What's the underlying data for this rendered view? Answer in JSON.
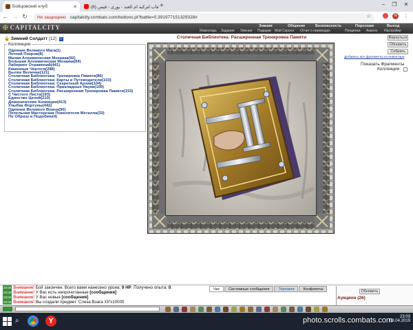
{
  "browser": {
    "tabs": [
      {
        "title": "Бойцовский клуб",
        "active": true
      },
      {
        "title": "(8) القاب لتركية ام العند - يورى - فيس",
        "active": false
      }
    ],
    "security": "Не защищено",
    "url": "capitalcity.combats.com/buttons.pl?battle=0.391977151329328#"
  },
  "game": {
    "logo": "CAPITALCITY",
    "menu_top": [
      "Знания",
      "Общение",
      "Безопасность",
      "Персонаж",
      "Выход"
    ],
    "menu_bottom": [
      "Инвентарь",
      "Задания",
      "Умения",
      "Подарки",
      "Мой Скролл",
      "Отчет о переводах",
      "Поединки",
      "Анкета",
      "Настройки"
    ]
  },
  "header": {
    "user": "Зимний Солдатт",
    "level": "[12]",
    "page_title": "Столичная Библиотека: Расширенная Тренировка Памяти"
  },
  "collections": {
    "legend": "Коллекции",
    "items": [
      "Одеяние Великого Мага(1)",
      "Летний Покров(8)",
      "Малая Алхимическая Мозаика(92)",
      "Большая Алхимическая Мозаика(94)",
      "Лабиринт Отражений(441)",
      "Каменные Чертоги(288)",
      "Былое Величие(121)",
      "Столичная Библиотека: Тренировка Памяти(86)",
      "Столичная Библиотека: Карты и Путеводители(103)",
      "Столичная Библиотека: Секретный Архив(104)",
      "Столичная Библиотека: Прикладные Науки(109)",
      "Столичная Библиотека: Расширенная Тренировка Памяти(153)",
      "С Чистого Листа(193)",
      "Единство Целей(210)",
      "Демонические Конкиции(413)",
      "Улыбка Фортуны(442)",
      "Одеяние Великого Воина(90)",
      "Пепельная Мастерская Повелителя Металла(33)",
      "По Образу и Подобию(4)"
    ]
  },
  "controls": {
    "back": "Вернуться",
    "refresh": "Обновить",
    "collect": "Собрать",
    "add_all": "Добавить все фрагменты из инвентаря",
    "show_fragments": "Показать Фрагменты",
    "collections_label": "Коллекции"
  },
  "chat": {
    "lines": [
      {
        "time": "23:00",
        "warn": "Внимание!",
        "text": "Бой закончен. Всего вами нанесено урона: ",
        "bold": "9 HP",
        "text2": ". Получено опыта: ",
        "bold2": "0",
        "text3": "."
      },
      {
        "time": "23:00",
        "warn": "Внимание!",
        "text": "У Вас есть непрочитанные ",
        "bold": "[сообщения]",
        "text2": "",
        "bold2": "",
        "text3": ""
      },
      {
        "time": "23:00",
        "warn": "Внимание!",
        "text": "У Вас новые ",
        "bold": "[сообщения]",
        "text2": "",
        "bold2": "",
        "text3": ""
      },
      {
        "time": "23:00",
        "warn": "Внимание!",
        "text": "Вы создали предмет 'Слеза Вэага XII'x10000",
        "bold": "",
        "text2": "",
        "bold2": "",
        "text3": ""
      }
    ],
    "tabs": [
      "Чат",
      "Системные сообщения",
      "Торговля",
      "Конфликты"
    ],
    "refresh": "Обновить",
    "auction": "Аукцион (26)"
  },
  "taskbar": {
    "clock_time": "23:03",
    "clock_date": "08.04.2019"
  },
  "watermark": "photo.scrolls.combats.com"
}
